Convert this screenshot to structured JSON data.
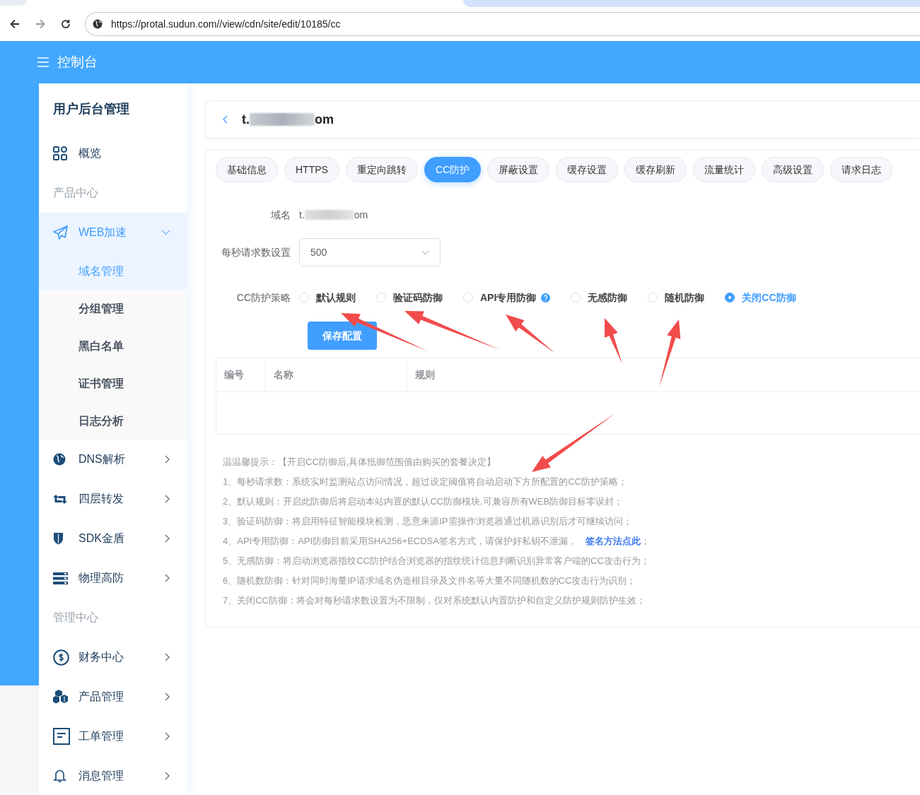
{
  "browser": {
    "url": "https://protal.sudun.com//view/cdn/site/edit/10185/cc"
  },
  "header": {
    "title": "控制台"
  },
  "sidebar": {
    "title": "用户后台管理",
    "items": [
      {
        "kind": "link",
        "label": "概览",
        "selected": false
      },
      {
        "kind": "section",
        "label": "产品中心"
      },
      {
        "kind": "group",
        "label": "WEB加速",
        "expanded": true,
        "selected": true,
        "children": [
          {
            "label": "域名管理",
            "selected": true
          },
          {
            "label": "分组管理",
            "selected": false
          },
          {
            "label": "黑白名单",
            "selected": false
          },
          {
            "label": "证书管理",
            "selected": false
          },
          {
            "label": "日志分析",
            "selected": false
          }
        ]
      },
      {
        "kind": "group",
        "label": "DNS解析",
        "expanded": false,
        "selected": false
      },
      {
        "kind": "group",
        "label": "四层转发",
        "expanded": false,
        "selected": false
      },
      {
        "kind": "group",
        "label": "SDK金盾",
        "expanded": false,
        "selected": false
      },
      {
        "kind": "group",
        "label": "物理高防",
        "expanded": false,
        "selected": false
      },
      {
        "kind": "section",
        "label": "管理中心"
      },
      {
        "kind": "group",
        "label": "财务中心",
        "expanded": false,
        "selected": false
      },
      {
        "kind": "group",
        "label": "产品管理",
        "expanded": false,
        "selected": false
      },
      {
        "kind": "group",
        "label": "工单管理",
        "expanded": false,
        "selected": false
      },
      {
        "kind": "group",
        "label": "消息管理",
        "expanded": false,
        "selected": false
      }
    ]
  },
  "site_card": {
    "title_start": "t.",
    "title_end": "om"
  },
  "tabs": [
    {
      "label": "基础信息",
      "selected": false
    },
    {
      "label": "HTTPS",
      "selected": false
    },
    {
      "label": "重定向跳转",
      "selected": false
    },
    {
      "label": "CC防护",
      "selected": true
    },
    {
      "label": "屏蔽设置",
      "selected": false
    },
    {
      "label": "缓存设置",
      "selected": false
    },
    {
      "label": "缓存刷新",
      "selected": false
    },
    {
      "label": "流量统计",
      "selected": false
    },
    {
      "label": "高级设置",
      "selected": false
    },
    {
      "label": "请求日志",
      "selected": false
    }
  ],
  "form": {
    "domain": {
      "label": "域名",
      "value_start": "t.",
      "value_end": "om"
    },
    "rate": {
      "label": "每秒请求数设置",
      "value": "500"
    },
    "strategy": {
      "label": "CC防护策略",
      "options": [
        {
          "label": "默认规则",
          "selected": false,
          "help": false
        },
        {
          "label": "验证码防御",
          "selected": false,
          "help": false
        },
        {
          "label": "API专用防御",
          "selected": false,
          "help": true
        },
        {
          "label": "无感防御",
          "selected": false,
          "help": false
        },
        {
          "label": "随机防御",
          "selected": false,
          "help": false
        },
        {
          "label": "关闭CC防御",
          "selected": true,
          "help": false
        }
      ]
    },
    "save_button": "保存配置"
  },
  "table": {
    "columns": [
      "编号",
      "名称",
      "规则"
    ]
  },
  "tips": {
    "title": "温温馨提示：【开启CC防御后,具体抵御范围值由购买的套餐决定】",
    "items": [
      {
        "text": "1、每秒请求数：系统实时监测站点访问情况，超过设定阈值将自动启动下方所配置的CC防护策略；"
      },
      {
        "text": "2、默认规则：开启此防御后将启动本站内置的默认CC防御模块,可兼容所有WEB防御目标零误封；"
      },
      {
        "text": "3、验证码防御：将启用特征智能模块检测，恶意来源IP需操作浏览器通过机器识别后才可继续访问；"
      },
      {
        "text": "4、API专用防御：API防御目前采用SHA256+ECDSA签名方式，请保护好私钥不泄漏，",
        "link": "签名方法点此",
        "after": "；"
      },
      {
        "text": "5、无感防御：将启动浏览器指纹CC防护结合浏览器的指纹统计信息判断识别异常客户端的CC攻击行为；"
      },
      {
        "text": "6、随机数防御：针对同时海量IP请求域名伪造根目录及文件名等大量不同随机数的CC攻击行为识别；"
      },
      {
        "text": "7、关闭CC防御：将会对每秒请求数设置为不限制，仅对系统默认内置防护和自定义防护规则防护生效；"
      }
    ]
  }
}
